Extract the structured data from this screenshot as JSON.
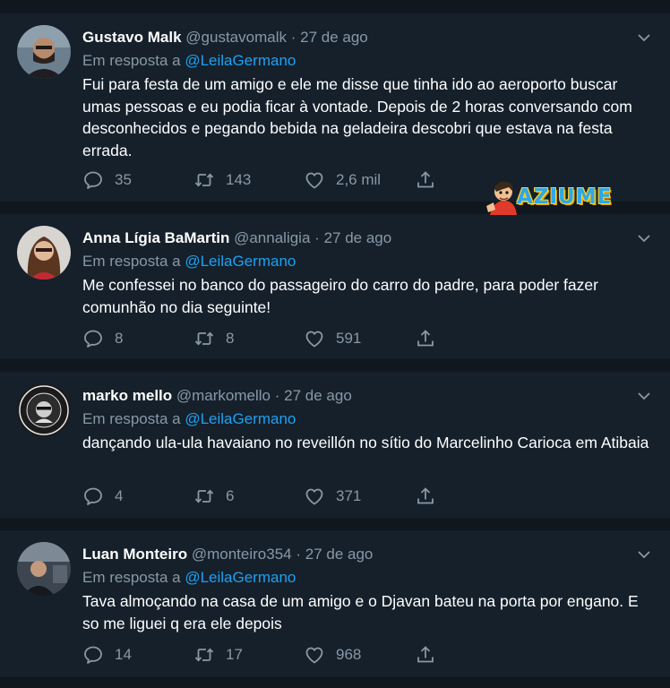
{
  "watermark": {
    "brand": "AZIUME"
  },
  "tweets": [
    {
      "name": "Gustavo Malk",
      "handle": "@gustavomalk",
      "separator": "·",
      "date": "27 de ago",
      "reply_prefix": "Em resposta a ",
      "reply_to": "@LeilaGermano",
      "text": "Fui para festa de um amigo e ele me disse que tinha ido ao aeroporto buscar umas pessoas e eu podia ficar à vontade. Depois de 2 horas conversando com desconhecidos e pegando bebida na geladeira descobri que estava na festa errada.",
      "replies": "35",
      "retweets": "143",
      "likes": "2,6 mil"
    },
    {
      "name": "Anna Lígia BaMartin",
      "handle": "@annaligia",
      "separator": "·",
      "date": "27 de ago",
      "reply_prefix": "Em resposta a ",
      "reply_to": "@LeilaGermano",
      "text": "Me confessei no banco do passageiro do carro do padre, para poder fazer comunhão no dia seguinte!",
      "replies": "8",
      "retweets": "8",
      "likes": "591"
    },
    {
      "name": "marko mello",
      "handle": "@markomello",
      "separator": "·",
      "date": "27 de ago",
      "reply_prefix": "Em resposta a ",
      "reply_to": "@LeilaGermano",
      "text": "dançando ula-ula havaiano no reveillón no sítio do Marcelinho Carioca em Atibaia",
      "replies": "4",
      "retweets": "6",
      "likes": "371"
    },
    {
      "name": "Luan Monteiro",
      "handle": "@monteiro354",
      "separator": "·",
      "date": "27 de ago",
      "reply_prefix": "Em resposta a ",
      "reply_to": "@LeilaGermano",
      "text": "Tava almoçando na casa de um amigo e o Djavan bateu na porta por engano. E so me liguei q era ele depois",
      "replies": "14",
      "retweets": "17",
      "likes": "968"
    }
  ]
}
